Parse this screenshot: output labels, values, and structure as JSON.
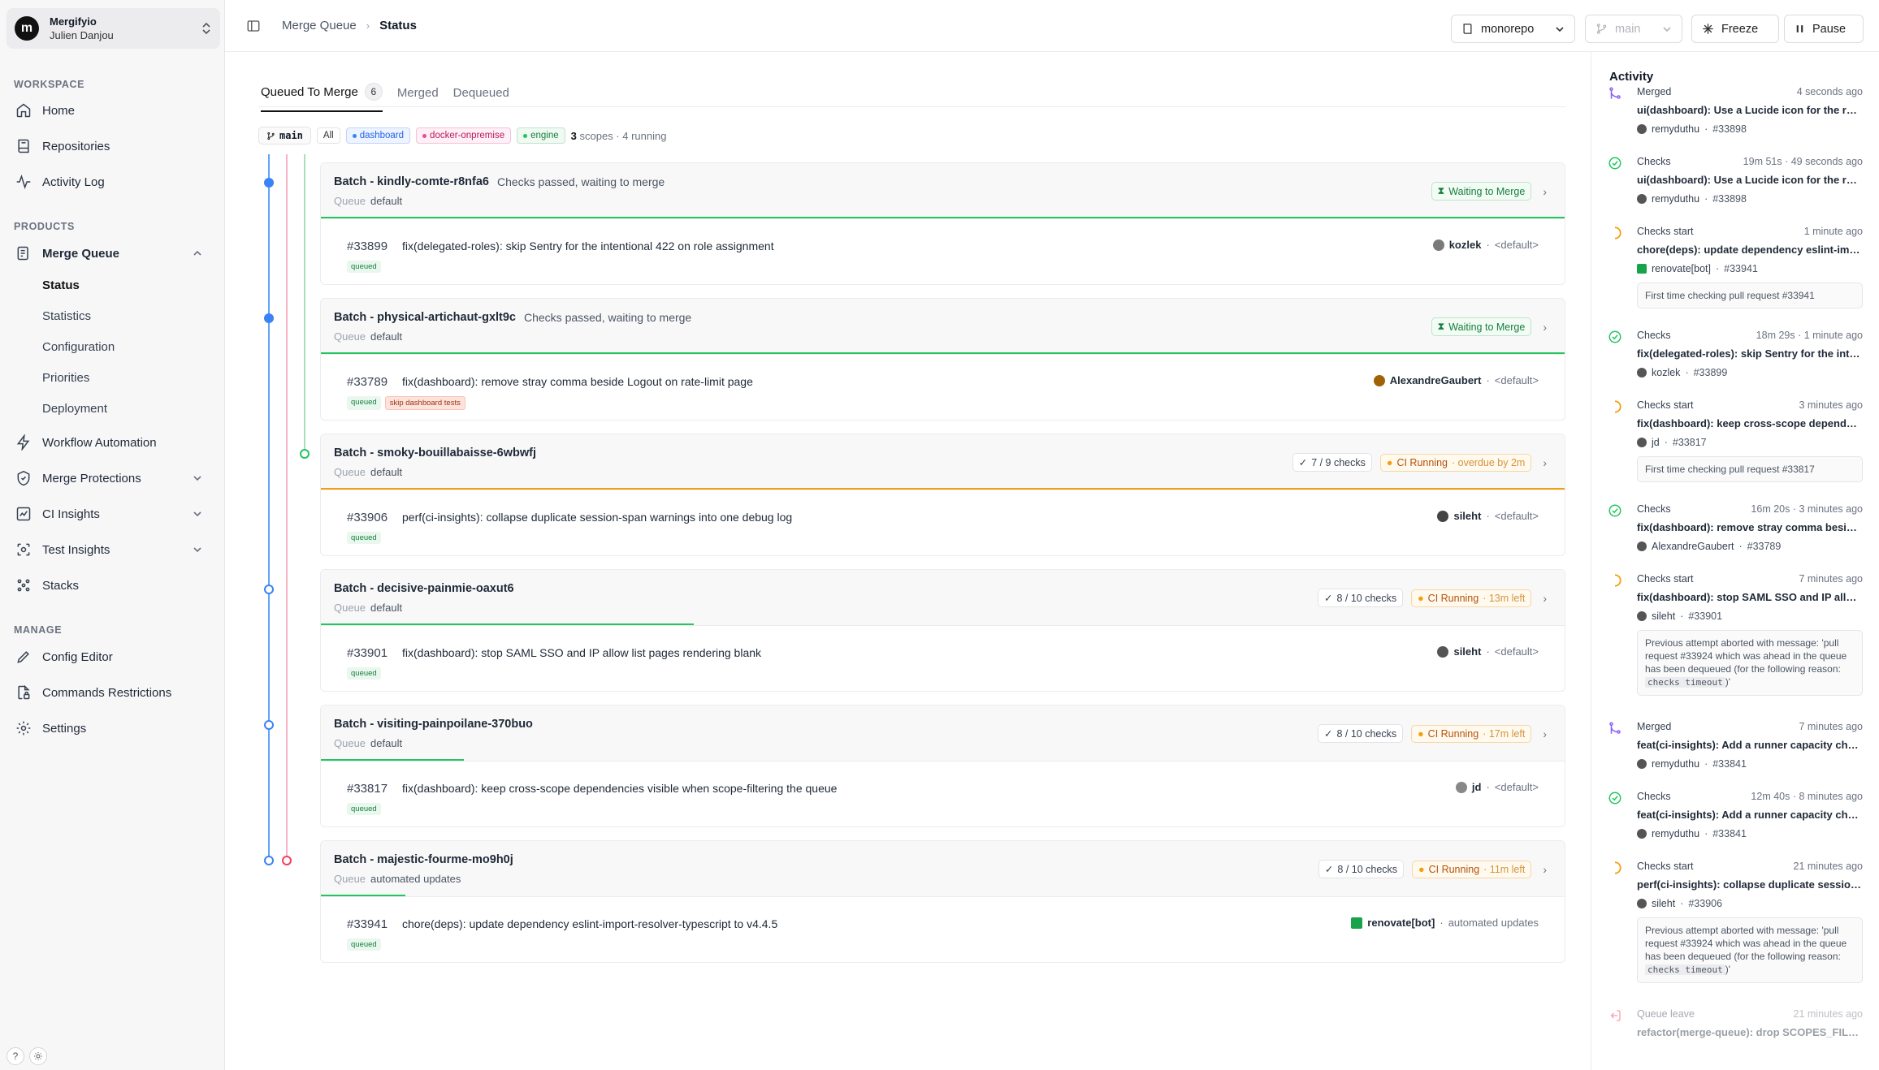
{
  "org": {
    "logo": "m",
    "name": "Mergifyio",
    "user": "Julien Danjou"
  },
  "sidebar": {
    "sections": {
      "workspace": "WORKSPACE",
      "products": "PRODUCTS",
      "manage": "MANAGE"
    },
    "workspace_items": [
      {
        "label": "Home",
        "icon": "home-icon"
      },
      {
        "label": "Repositories",
        "icon": "book-icon"
      },
      {
        "label": "Activity Log",
        "icon": "activity-icon"
      }
    ],
    "merge_queue": {
      "label": "Merge Queue",
      "subitems": [
        "Status",
        "Statistics",
        "Configuration",
        "Priorities",
        "Deployment"
      ]
    },
    "product_items": [
      {
        "label": "Workflow Automation",
        "icon": "zap-icon"
      },
      {
        "label": "Merge Protections",
        "icon": "shield-icon"
      },
      {
        "label": "CI Insights",
        "icon": "chart-icon"
      },
      {
        "label": "Test Insights",
        "icon": "test-icon"
      },
      {
        "label": "Stacks",
        "icon": "stacks-icon"
      }
    ],
    "manage_items": [
      {
        "label": "Config Editor",
        "icon": "pencil-icon"
      },
      {
        "label": "Commands Restrictions",
        "icon": "lock-file-icon"
      },
      {
        "label": "Settings",
        "icon": "gear-icon"
      }
    ],
    "footer": {
      "help": "?"
    }
  },
  "topbar": {
    "breadcrumb": [
      "Merge Queue",
      "Status"
    ],
    "repo": "monorepo",
    "branch": "main",
    "freeze": "Freeze",
    "pause": "Pause"
  },
  "tabs": [
    {
      "label": "Queued To Merge",
      "count": "6"
    },
    {
      "label": "Merged"
    },
    {
      "label": "Dequeued"
    }
  ],
  "branch_filter": {
    "branch": "main",
    "all": "All",
    "scopes": [
      {
        "label": "dashboard",
        "color": "#2563eb"
      },
      {
        "label": "docker-onpremise",
        "color": "#db2777"
      },
      {
        "label": "engine",
        "color": "#16a34a"
      }
    ],
    "scope_count": "3",
    "scope_text": "scopes · 4 running"
  },
  "batches": [
    {
      "name": "Batch - kindly-comte-r8nfa6",
      "status": "Checks passed, waiting to merge",
      "queue_label": "Queue",
      "queue": "default",
      "badge": "Waiting to Merge",
      "checks": "",
      "ci": "",
      "ci_extra": "",
      "progress": 1.0,
      "pr": {
        "number": "#33899",
        "title": "fix(delegated-roles): skip Sentry for the intentional 422 on role assignment",
        "tags": [
          "queued"
        ],
        "author": "kozlek",
        "queue": "<default>"
      }
    },
    {
      "name": "Batch - physical-artichaut-gxlt9c",
      "status": "Checks passed, waiting to merge",
      "queue_label": "Queue",
      "queue": "default",
      "badge": "Waiting to Merge",
      "checks": "",
      "ci": "",
      "ci_extra": "",
      "progress": 1.0,
      "pr": {
        "number": "#33789",
        "title": "fix(dashboard): remove stray comma beside Logout on rate-limit page",
        "tags": [
          "queued",
          "skip dashboard tests"
        ],
        "author": "AlexandreGaubert",
        "queue": "<default>"
      }
    },
    {
      "name": "Batch - smoky-bouillabaisse-6wbwfj",
      "status": "",
      "queue_label": "Queue",
      "queue": "default",
      "badge": "",
      "checks": "7 / 9 checks",
      "ci": "CI Running",
      "ci_extra": "· overdue by 2m",
      "progress": 1.0,
      "pr": {
        "number": "#33906",
        "title": "perf(ci-insights): collapse duplicate session-span warnings into one debug log",
        "tags": [
          "queued"
        ],
        "author": "sileht",
        "queue": "<default>"
      }
    },
    {
      "name": "Batch - decisive-painmie-oaxut6",
      "status": "",
      "queue_label": "Queue",
      "queue": "default",
      "badge": "",
      "checks": "8 / 10 checks",
      "ci": "CI Running",
      "ci_extra": "· 13m left",
      "progress": 0.3,
      "pr": {
        "number": "#33901",
        "title": "fix(dashboard): stop SAML SSO and IP allow list pages rendering blank",
        "tags": [
          "queued"
        ],
        "author": "sileht",
        "queue": "<default>"
      }
    },
    {
      "name": "Batch - visiting-painpoilane-370buo",
      "status": "",
      "queue_label": "Queue",
      "queue": "default",
      "badge": "",
      "checks": "8 / 10 checks",
      "ci": "CI Running",
      "ci_extra": "· 17m left",
      "progress": 0.115,
      "pr": {
        "number": "#33817",
        "title": "fix(dashboard): keep cross-scope dependencies visible when scope-filtering the queue",
        "tags": [
          "queued"
        ],
        "author": "jd",
        "queue": "<default>"
      }
    },
    {
      "name": "Batch - majestic-fourme-mo9h0j",
      "status": "",
      "queue_label": "Queue",
      "queue": "automated updates",
      "badge": "",
      "checks": "8 / 10 checks",
      "ci": "CI Running",
      "ci_extra": "· 11m left",
      "progress": 0.068,
      "pr": {
        "number": "#33941",
        "title": "chore(deps): update dependency eslint-import-resolver-typescript to v4.4.5",
        "tags": [
          "queued"
        ],
        "author": "renovate[bot]",
        "queue": "automated updates"
      }
    }
  ],
  "activity": {
    "title": "Activity",
    "events": [
      {
        "type": "Merged",
        "time": "4 seconds ago",
        "title": "ui(dashboard): Use a Lucide icon for the runne...",
        "author": "remyduthu",
        "pr": "#33898",
        "note": "",
        "icon": "merged"
      },
      {
        "type": "Checks",
        "time": "19m 51s · 49 seconds ago",
        "title": "ui(dashboard): Use a Lucide icon for the runne...",
        "author": "remyduthu",
        "pr": "#33898",
        "note": "",
        "icon": "checks"
      },
      {
        "type": "Checks start",
        "time": "1 minute ago",
        "title": "chore(deps): update dependency eslint-import...",
        "author": "renovate[bot]",
        "pr": "#33941",
        "note": "First time checking pull request #33941",
        "icon": "start"
      },
      {
        "type": "Checks",
        "time": "18m 29s · 1 minute ago",
        "title": "fix(delegated-roles): skip Sentry for the intenti...",
        "author": "kozlek",
        "pr": "#33899",
        "note": "",
        "icon": "checks"
      },
      {
        "type": "Checks start",
        "time": "3 minutes ago",
        "title": "fix(dashboard): keep cross-scope dependenci...",
        "author": "jd",
        "pr": "#33817",
        "note": "First time checking pull request #33817",
        "icon": "start"
      },
      {
        "type": "Checks",
        "time": "16m 20s · 3 minutes ago",
        "title": "fix(dashboard): remove stray comma beside Lo...",
        "author": "AlexandreGaubert",
        "pr": "#33789",
        "note": "",
        "icon": "checks"
      },
      {
        "type": "Checks start",
        "time": "7 minutes ago",
        "title": "fix(dashboard): stop SAML SSO and IP allow lis...",
        "author": "sileht",
        "pr": "#33901",
        "note_parts": [
          "Previous attempt aborted with message: 'pull request #33924 which was ahead in the queue has been dequeued (for the following reason: ",
          "checks timeout",
          ")'"
        ],
        "icon": "start"
      },
      {
        "type": "Merged",
        "time": "7 minutes ago",
        "title": "feat(ci-insights): Add a runner capacity chart t...",
        "author": "remyduthu",
        "pr": "#33841",
        "note": "",
        "icon": "merged"
      },
      {
        "type": "Checks",
        "time": "12m 40s · 8 minutes ago",
        "title": "feat(ci-insights): Add a runner capacity chart t...",
        "author": "remyduthu",
        "pr": "#33841",
        "note": "",
        "icon": "checks"
      },
      {
        "type": "Checks start",
        "time": "21 minutes ago",
        "title": "perf(ci-insights): collapse duplicate session-sp...",
        "author": "sileht",
        "pr": "#33906",
        "note_parts": [
          "Previous attempt aborted with message: 'pull request #33924 which was ahead in the queue has been dequeued (for the following reason: ",
          "checks timeout",
          ")'"
        ],
        "icon": "start"
      },
      {
        "type": "Queue leave",
        "time": "21 minutes ago",
        "title": "refactor(merge-queue): drop SCOPES_FILES_E...",
        "author": "",
        "pr": "",
        "note": "",
        "icon": "leave"
      }
    ]
  },
  "colors": {
    "accent_blue": "#3b82f6",
    "green": "#22c55e",
    "orange": "#f59e0b",
    "red": "#f43f5e",
    "purple": "#8b5cf6"
  }
}
